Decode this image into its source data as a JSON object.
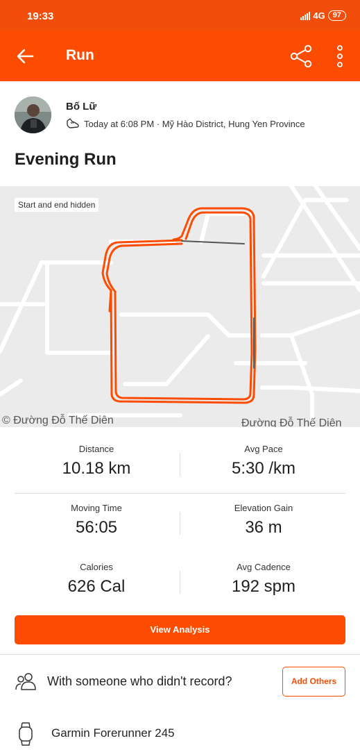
{
  "status_bar": {
    "time": "19:33",
    "network": "4G",
    "battery": "97"
  },
  "header": {
    "title": "Run"
  },
  "athlete": {
    "name": "Bố Lữ",
    "meta": "Today at 6:08 PM · Mỹ Hào District, Hung Yen Province"
  },
  "activity": {
    "title": "Evening Run"
  },
  "map": {
    "badge": "Start and end hidden",
    "street_left": "© Đường Đỗ Thế Diên",
    "street_right": "Đường Đỗ Thế Diên",
    "route_color": "#fc4c02"
  },
  "stats": [
    {
      "label": "Distance",
      "value": "10.18 km"
    },
    {
      "label": "Avg Pace",
      "value": "5:30 /km"
    },
    {
      "label": "Moving Time",
      "value": "56:05"
    },
    {
      "label": "Elevation Gain",
      "value": "36 m"
    },
    {
      "label": "Calories",
      "value": "626 Cal"
    },
    {
      "label": "Avg Cadence",
      "value": "192 spm"
    }
  ],
  "actions": {
    "view_analysis": "View Analysis",
    "others_prompt": "With someone who didn't record?",
    "add_others": "Add Others"
  },
  "device": {
    "name": "Garmin Forerunner 245"
  },
  "colors": {
    "brand": "#fc4c02",
    "status_bar": "#f04e0a"
  }
}
